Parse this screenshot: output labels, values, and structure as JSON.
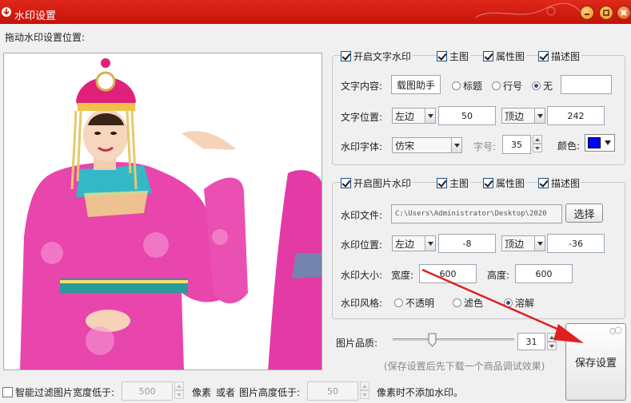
{
  "window": {
    "title": "水印设置",
    "close_label": "×"
  },
  "drag_label": "拖动水印设置位置:",
  "text_watermark": {
    "enable_label": "开启文字水印",
    "enabled": true,
    "targets": [
      {
        "label": "主图",
        "checked": true
      },
      {
        "label": "属性图",
        "checked": true
      },
      {
        "label": "描述图",
        "checked": true
      }
    ],
    "content_label": "文字内容:",
    "content_value": "载图助手",
    "content_options": [
      {
        "label": "标题",
        "selected": false
      },
      {
        "label": "行号",
        "selected": false
      },
      {
        "label": "无",
        "selected": true
      }
    ],
    "extra_value": "",
    "position_label": "文字位置:",
    "h_anchor": "左边",
    "h_offset": "50",
    "v_anchor": "顶边",
    "v_offset": "242",
    "font_label": "水印字体:",
    "font_value": "仿宋",
    "size_label": "字号:",
    "size_value": "35",
    "color_label": "颜色:",
    "color_value": "#0000ff"
  },
  "image_watermark": {
    "enable_label": "开启图片水印",
    "enabled": true,
    "targets": [
      {
        "label": "主图",
        "checked": true
      },
      {
        "label": "属性图",
        "checked": true
      },
      {
        "label": "描述图",
        "checked": true
      }
    ],
    "file_label": "水印文件:",
    "file_path": "C:\\Users\\Administrator\\Desktop\\2020",
    "choose_label": "选择",
    "position_label": "水印位置:",
    "h_anchor": "左边",
    "h_offset": "-8",
    "v_anchor": "顶边",
    "v_offset": "-36",
    "size_label": "水印大小:",
    "width_label": "宽度:",
    "width_value": "600",
    "height_label": "高度:",
    "height_value": "600",
    "style_label": "水印风格:",
    "style_options": [
      {
        "label": "不透明",
        "selected": false
      },
      {
        "label": "滤色",
        "selected": false
      },
      {
        "label": "溶解",
        "selected": true
      }
    ]
  },
  "quality": {
    "label": "图片品质:",
    "value": "31",
    "fraction": 0.31,
    "hint": "(保存设置后先下载一个商品调试效果)"
  },
  "save_label": "保存设置",
  "filter": {
    "checkbox_label": "智能过滤图片宽度低于:",
    "checked": false,
    "width_value": "500",
    "px_label": "像素",
    "or_label": "或者",
    "height_label": "图片高度低于:",
    "height_value": "50",
    "suffix": "像素时不添加水印。"
  },
  "colors": {
    "titlebar": "#d21f12",
    "accent_arrow": "#e02020",
    "swatch": "#0000ff"
  }
}
